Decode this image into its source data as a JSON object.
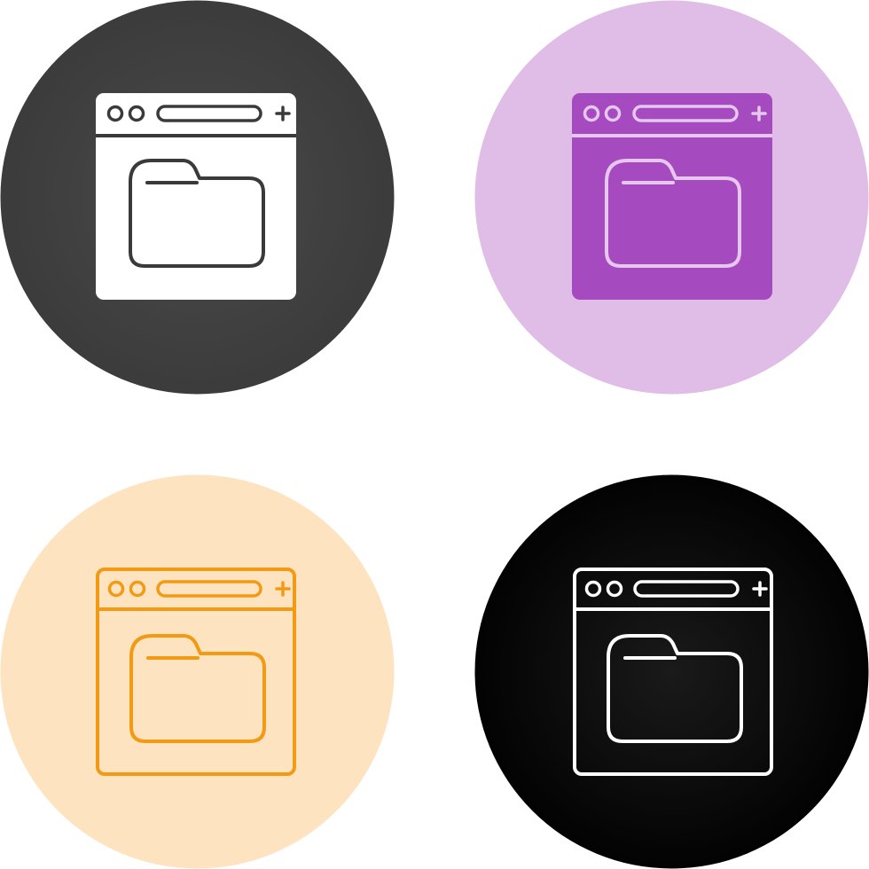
{
  "icons": [
    {
      "name": "browser-folder-icon",
      "style": "glyph",
      "circle_color": "#3a3a3a",
      "circle_gradient_light": "#4a4a4a",
      "icon_color": "#ffffff",
      "detail_color": "#3a3a3a"
    },
    {
      "name": "browser-folder-icon",
      "style": "glyph",
      "circle_color": "#dfbde6",
      "icon_color": "#a64bbf",
      "detail_color": "#e6c7ee"
    },
    {
      "name": "browser-folder-icon",
      "style": "outline",
      "circle_color": "#fde3c0",
      "icon_color": "#f39a14"
    },
    {
      "name": "browser-folder-icon",
      "style": "outline",
      "circle_color": "#000000",
      "circle_gradient_light": "#1a1a1a",
      "icon_color": "#ffffff"
    }
  ]
}
